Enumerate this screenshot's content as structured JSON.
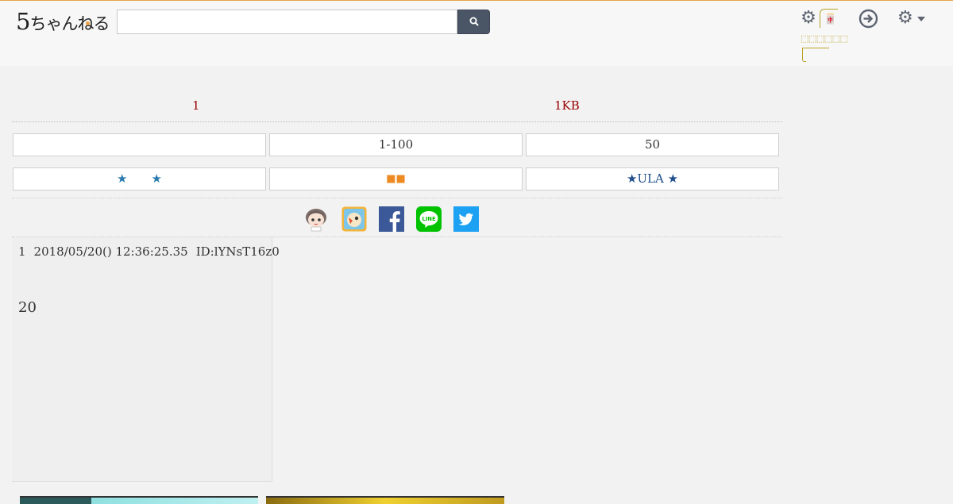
{
  "header": {
    "logo_small": "ちゃんねる",
    "logo_big": "5",
    "search_placeholder": "",
    "top_label": "🀄",
    "link_label": "⬚⬚⬚⬚⬚⬚"
  },
  "thread_meta": {
    "count": "1",
    "size": "1KB"
  },
  "nav_row_1": [
    "",
    "1-100",
    "50"
  ],
  "nav_row_2": [
    "★　　★",
    "■■",
    "★ULA ★"
  ],
  "nav_row_2_colors": [
    "#2a7ab0",
    "#ee8a22",
    "#1f4e8c"
  ],
  "share_icons": [
    "mascot-icon",
    "app-icon",
    "facebook-icon",
    "line-icon",
    "twitter-icon"
  ],
  "post": {
    "number": "1",
    "datetime": "2018/05/20() 12:36:25.35",
    "id": "ID:lYNsT16z0",
    "body": "20"
  },
  "colors": {
    "accent": "#e8a245",
    "meta_red": "#990000",
    "search_button": "#4a5566",
    "link_yellow": "#b8a327",
    "facebook": "#3b5998",
    "line": "#00c300",
    "twitter": "#1da1f2"
  }
}
